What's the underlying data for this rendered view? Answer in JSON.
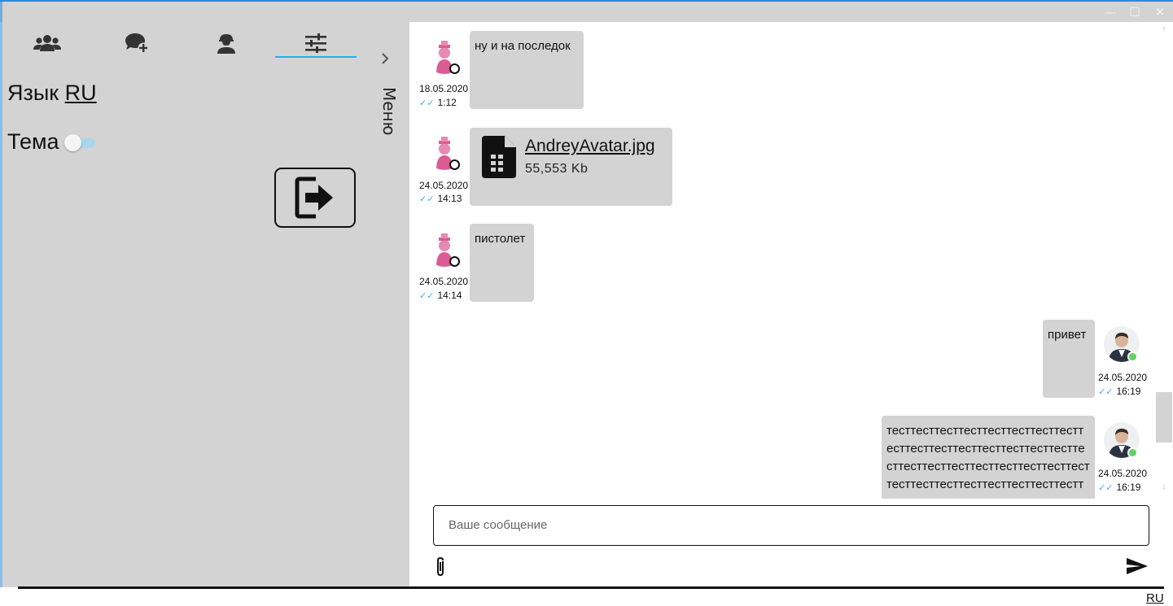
{
  "window": {
    "controls": {
      "minimize": "—",
      "maximize": "☐",
      "close": "✕"
    }
  },
  "sidebar": {
    "tabs": [
      {
        "icon": "users-group-icon"
      },
      {
        "icon": "new-chat-icon"
      },
      {
        "icon": "worker-profile-icon"
      },
      {
        "icon": "settings-sliders-icon",
        "active": true
      }
    ],
    "menu_label": "Меню",
    "language_label": "Язык",
    "language_value": "RU",
    "theme_label": "Тема",
    "theme_enabled": false,
    "logout_icon": "logout-icon"
  },
  "messages": [
    {
      "side": "left",
      "avatar": "contact-avatar",
      "online": false,
      "text": "ну и на последок",
      "date": "18.05.2020",
      "time": "1:12"
    },
    {
      "side": "left",
      "avatar": "contact-avatar",
      "online": false,
      "file": {
        "name": "AndreyAvatar.jpg",
        "size": "55,553 Kb",
        "icon": "spreadsheet-file-icon"
      },
      "date": "24.05.2020",
      "time": "14:13"
    },
    {
      "side": "left",
      "avatar": "contact-avatar",
      "online": false,
      "text": "пистолет",
      "date": "24.05.2020",
      "time": "14:14"
    },
    {
      "side": "right",
      "avatar": "own-avatar",
      "online": true,
      "text": "привет",
      "date": "24.05.2020",
      "time": "16:19"
    },
    {
      "side": "right",
      "avatar": "own-avatar",
      "online": true,
      "text": "тесттесттесттесттесттесттесттесттесттесттесттесттесттесттесттесттесттесттесттесттесттесттесттесттесттесттесттесттесттесттесттесттесттесттесттесттесттесттесттесттест",
      "date": "24.05.2020",
      "time": "16:19"
    }
  ],
  "composer": {
    "placeholder": "Ваше сообщение",
    "attach_icon": "paperclip-icon",
    "send_icon": "send-icon"
  },
  "footer": {
    "language": "RU"
  },
  "colors": {
    "panel": "#d3d3d3",
    "accent": "#20b2e8",
    "read_ticks": "#3ab0e6",
    "online": "#5fd35f"
  }
}
